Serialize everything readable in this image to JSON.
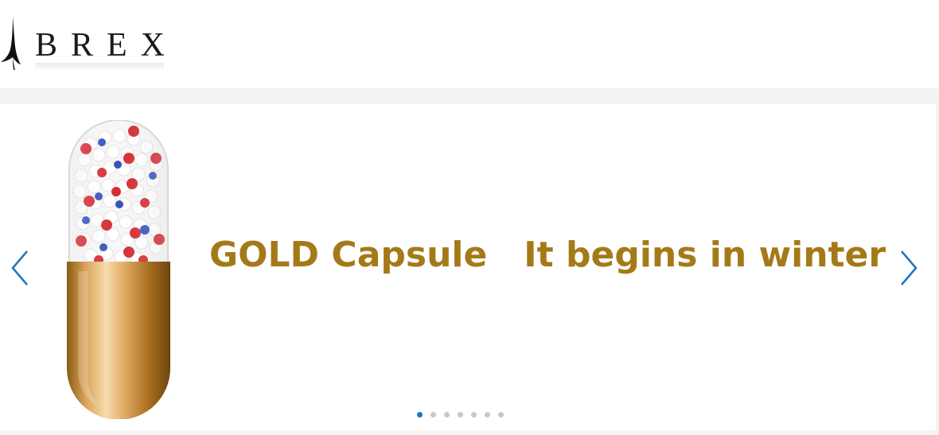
{
  "header": {
    "logo_text": "BREX"
  },
  "slider": {
    "headline": "GOLD Capsule   It begins in winter",
    "active_slide": 1,
    "slide_count": 7,
    "prev_icon": "chevron-left-icon",
    "next_icon": "chevron-right-icon",
    "accent_color": "#a47a18",
    "arrow_color": "#1e73be"
  }
}
